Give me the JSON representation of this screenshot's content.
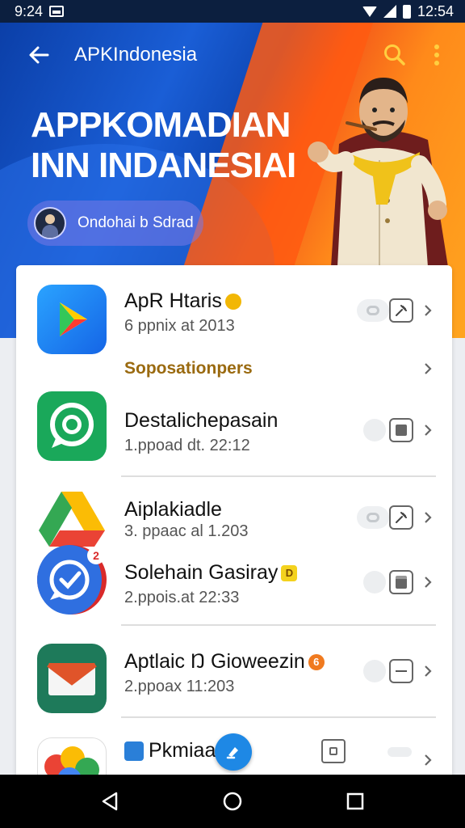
{
  "status_bar": {
    "time": "9:24",
    "right_time": "12:54"
  },
  "app_bar": {
    "title": "APKIndonesia"
  },
  "hero": {
    "title_line1": "APPKOMADIAN",
    "title_line2": "INN INDANESIAI",
    "user_chip": "Ondohai b Sdrad"
  },
  "apps": [
    {
      "name": "ApR Htaris",
      "meta": "6 ppnix at 2013",
      "icon": "google-play-icon",
      "badge_color": "#f2b705"
    },
    {
      "name": "Destalichepasain",
      "meta": "1.ppoad dt. 22:12",
      "icon": "whatsapp-icon"
    },
    {
      "name": "Aiplakiadle",
      "meta": "3. ppaac al 1.203",
      "icon": "google-drive-icon"
    },
    {
      "name": "Solehain Gasiray",
      "meta": "2.ppois.at 22:33",
      "icon": "messenger-check-icon",
      "badge_text": "D",
      "badge_color": "#f4d21e"
    },
    {
      "name": "Aptlaic Ŋ Gioweezin",
      "meta": "2.ppoax 11:203",
      "icon": "gmail-icon",
      "badge_text": "6",
      "badge_color": "#f07a1f"
    },
    {
      "name": "Pkmiaan",
      "meta": "",
      "icon": "photos-icon"
    }
  ],
  "section": {
    "title": "Soposationpers"
  },
  "notification_count": "2",
  "colors": {
    "accent": "#1e88e5",
    "section_title": "#9a6a10",
    "hero_blue": "#0b3fa8",
    "hero_orange": "#ff8a1a"
  }
}
